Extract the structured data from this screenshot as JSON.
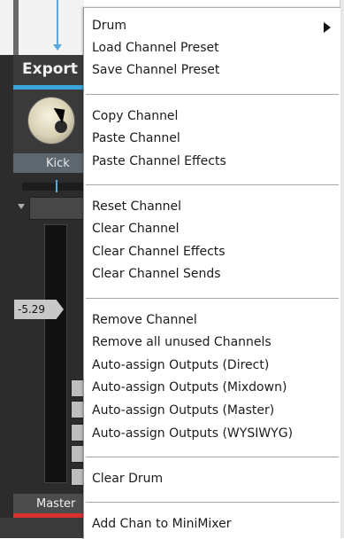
{
  "mixer": {
    "export_label": "Export",
    "channel_name": "Kick",
    "fader_value": "-5.29",
    "master_label": "Master"
  },
  "menu": {
    "items": [
      "Drum",
      "Load Channel Preset",
      "Save Channel Preset",
      "Copy Channel",
      "Paste Channel",
      "Paste Channel Effects",
      "Reset Channel",
      "Clear Channel",
      "Clear Channel Effects",
      "Clear Channel Sends",
      "Remove Channel",
      "Remove all unused Channels",
      "Auto-assign Outputs (Direct)",
      "Auto-assign Outputs (Mixdown)",
      "Auto-assign Outputs (Master)",
      "Auto-assign Outputs (WYSIWYG)",
      "Clear Drum",
      "Add Chan to MiniMixer"
    ]
  },
  "colors": {
    "accent_blue": "#38a6d8",
    "master_red": "#d83030"
  }
}
